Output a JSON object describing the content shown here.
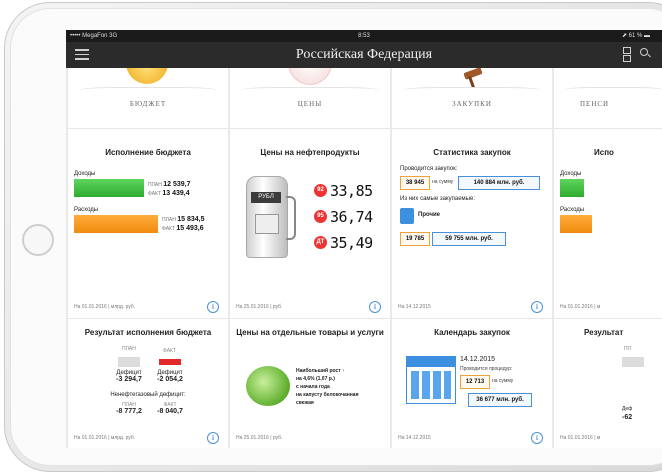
{
  "status_bar": {
    "carrier": "••••• MegaFon  3G",
    "time": "8:53",
    "battery": "⬈ 61 % ▬"
  },
  "nav": {
    "title": "Российская Федерация"
  },
  "columns": [
    {
      "category": "БЮДЖЕТ",
      "emblem_color": "#f6c232",
      "panel1": {
        "title": "Исполнение бюджета",
        "income_label": "Доходы",
        "income_plan_label": "ПЛАН",
        "income_plan_value": "12 539,7",
        "income_fact_label": "ФАКТ",
        "income_fact_value": "13 439,4",
        "expense_label": "Расходы",
        "expense_plan_label": "ПЛАН",
        "expense_plan_value": "15 834,5",
        "expense_fact_label": "ФАКТ",
        "expense_fact_value": "15 493,6",
        "footer": "На 01.01.2016 | млрд. руб."
      },
      "panel2": {
        "title": "Результат исполнения бюджета",
        "plan_label": "ПЛАН",
        "fact_label": "ФАКТ",
        "deficit_label_1": "Дефицит",
        "deficit_value_1": "-3 294,7",
        "deficit_label_2": "Дефицит",
        "deficit_value_2": "-2 054,2",
        "nonoil_label": "Ненефтегазовый дефицит:",
        "nonoil_plan_label": "ПЛАН",
        "nonoil_plan_value": "-8 777,2",
        "nonoil_fact_label": "ФАКТ",
        "nonoil_fact_value": "-8 040,7",
        "footer": "На 01.01.2016 | млрд. руб."
      }
    },
    {
      "category": "ЦЕНЫ",
      "panel1": {
        "title": "Цены на нефтепродукты",
        "pump_label": "РУБЛ",
        "fuels": [
          {
            "grade": "92",
            "price": "33,85"
          },
          {
            "grade": "95",
            "price": "36,74"
          },
          {
            "grade": "ДТ",
            "price": "35,49"
          }
        ],
        "footer": "На 25.01.2016 | руб."
      },
      "panel2": {
        "title": "Цены на отдельные товары и услуги",
        "line1": "Наибольший рост ↑",
        "line2": "на 4,6% (1,07 р.)",
        "line3": "с начала года",
        "line4": "на капусту белокочанная",
        "line5": "свежая",
        "footer": "На 25.01.2016 | руб."
      }
    },
    {
      "category": "ЗАКУПКИ",
      "panel1": {
        "title": "Статистика закупок",
        "conducted_label": "Проводится закупок:",
        "count": "38 945",
        "sum_label": "на сумму",
        "sum": "140 884 млн. руб.",
        "top_label": "Из них самые закупаемые:",
        "category_name": "Прочие",
        "cat_count": "19 785",
        "cat_sum": "59 755 млн. руб.",
        "footer": "На 14.12.2015"
      },
      "panel2": {
        "title": "Календарь закупок",
        "date": "14.12.2015",
        "procedures_label": "Проводится процедур:",
        "procedures_count": "12 713",
        "sum_label": "на сумму",
        "sum": "36 677 млн. руб.",
        "footer": "На 14.12.2015"
      }
    },
    {
      "category": "ПЕНСИ",
      "panel1": {
        "title": "Испо",
        "income_label": "Доходы",
        "expense_label": "Расходы",
        "footer": "На 01.01.2016 | м"
      },
      "panel2": {
        "title": "Результат",
        "plan_label": "ПЛ",
        "deficit_label": "Деф",
        "deficit_value": "-62",
        "footer": "На 01.01.2016 | м"
      }
    }
  ],
  "colors": {
    "income": "#3fbf3f",
    "expense": "#f7941d",
    "accent": "#4a90d9",
    "fuel_badge": "#e33333"
  }
}
